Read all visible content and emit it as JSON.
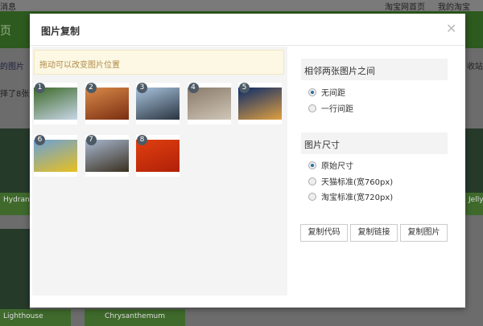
{
  "background": {
    "top_left": "消息",
    "top_links": [
      "淘宝网首页",
      "我的淘宝"
    ],
    "nav_fragment": "页",
    "side_text_1": "的图片",
    "side_text_2": "择了8张",
    "right_text": "收站",
    "tiles": [
      "Hydrangea",
      "Jellyfish",
      "Lighthouse",
      "Chrysanthemum"
    ]
  },
  "modal": {
    "title": "图片复制",
    "close_icon": "close-icon",
    "notice": "拖动可以改变图片位置",
    "images": [
      {
        "num": "1",
        "colors": [
          "#3d6b2a",
          "#c9d6e8"
        ]
      },
      {
        "num": "2",
        "colors": [
          "#d98a4a",
          "#7a2e10"
        ]
      },
      {
        "num": "3",
        "colors": [
          "#a9c4de",
          "#2a3440"
        ]
      },
      {
        "num": "4",
        "colors": [
          "#8a7a6a",
          "#cfc6b8"
        ]
      },
      {
        "num": "5",
        "colors": [
          "#0b2a6a",
          "#e0a040"
        ]
      },
      {
        "num": "6",
        "colors": [
          "#6aa0d8",
          "#e8c020"
        ]
      },
      {
        "num": "7",
        "colors": [
          "#a8b8d0",
          "#3a3020"
        ]
      },
      {
        "num": "8",
        "colors": [
          "#e04010",
          "#b02008"
        ]
      }
    ],
    "spacing": {
      "title": "相邻两张图片之间",
      "options": [
        "无间距",
        "一行间距"
      ],
      "selected": 0
    },
    "size": {
      "title": "图片尺寸",
      "options": [
        "原始尺寸",
        "天猫标准(宽760px)",
        "淘宝标准(宽720px)"
      ],
      "selected": 0
    },
    "buttons": [
      "复制代码",
      "复制链接",
      "复制图片"
    ]
  }
}
